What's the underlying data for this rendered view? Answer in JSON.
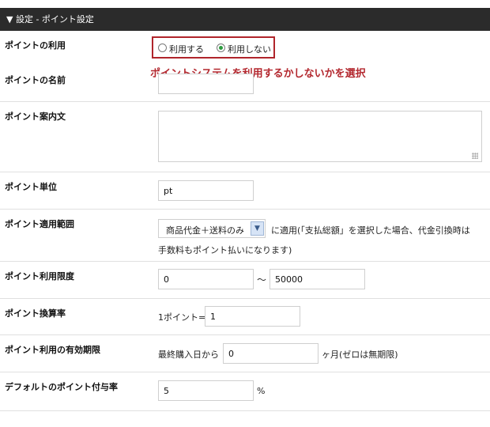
{
  "header": {
    "title": "▼ 設定 - ポイント設定"
  },
  "points_usage": {
    "label": "ポイントの利用",
    "options": [
      "利用する",
      "利用しない"
    ],
    "selected": "利用しない",
    "annotation": "ポイントシステムを利用するかしないかを選択"
  },
  "points_name": {
    "label": "ポイントの名前",
    "value": ""
  },
  "points_guide": {
    "label": "ポイント案内文",
    "value": ""
  },
  "points_unit": {
    "label": "ポイント単位",
    "value": "pt"
  },
  "points_scope": {
    "label": "ポイント適用範囲",
    "selected": "商品代金＋送料のみ",
    "note_line1": "に適用(「支払総額」を選択した場合、代金引換時は",
    "note_line2": "手数料もポイント払いになります)"
  },
  "points_limit": {
    "label": "ポイント利用限度",
    "min": "0",
    "separator": "〜",
    "max": "50000"
  },
  "points_rate": {
    "label": "ポイント換算率",
    "prefix": "1ポイント= ¥",
    "value": "1"
  },
  "points_expiry": {
    "label": "ポイント利用の有効期限",
    "prefix": "最終購入日から",
    "value": "0",
    "suffix": "ヶ月(ゼロは無期限)"
  },
  "default_grant": {
    "label": "デフォルトのポイント付与率",
    "value": "5",
    "suffix": "%"
  },
  "colors": {
    "header_bg": "#2b2b2b",
    "highlight": "#b0252b",
    "radio_checked": "#2c9a3e"
  }
}
